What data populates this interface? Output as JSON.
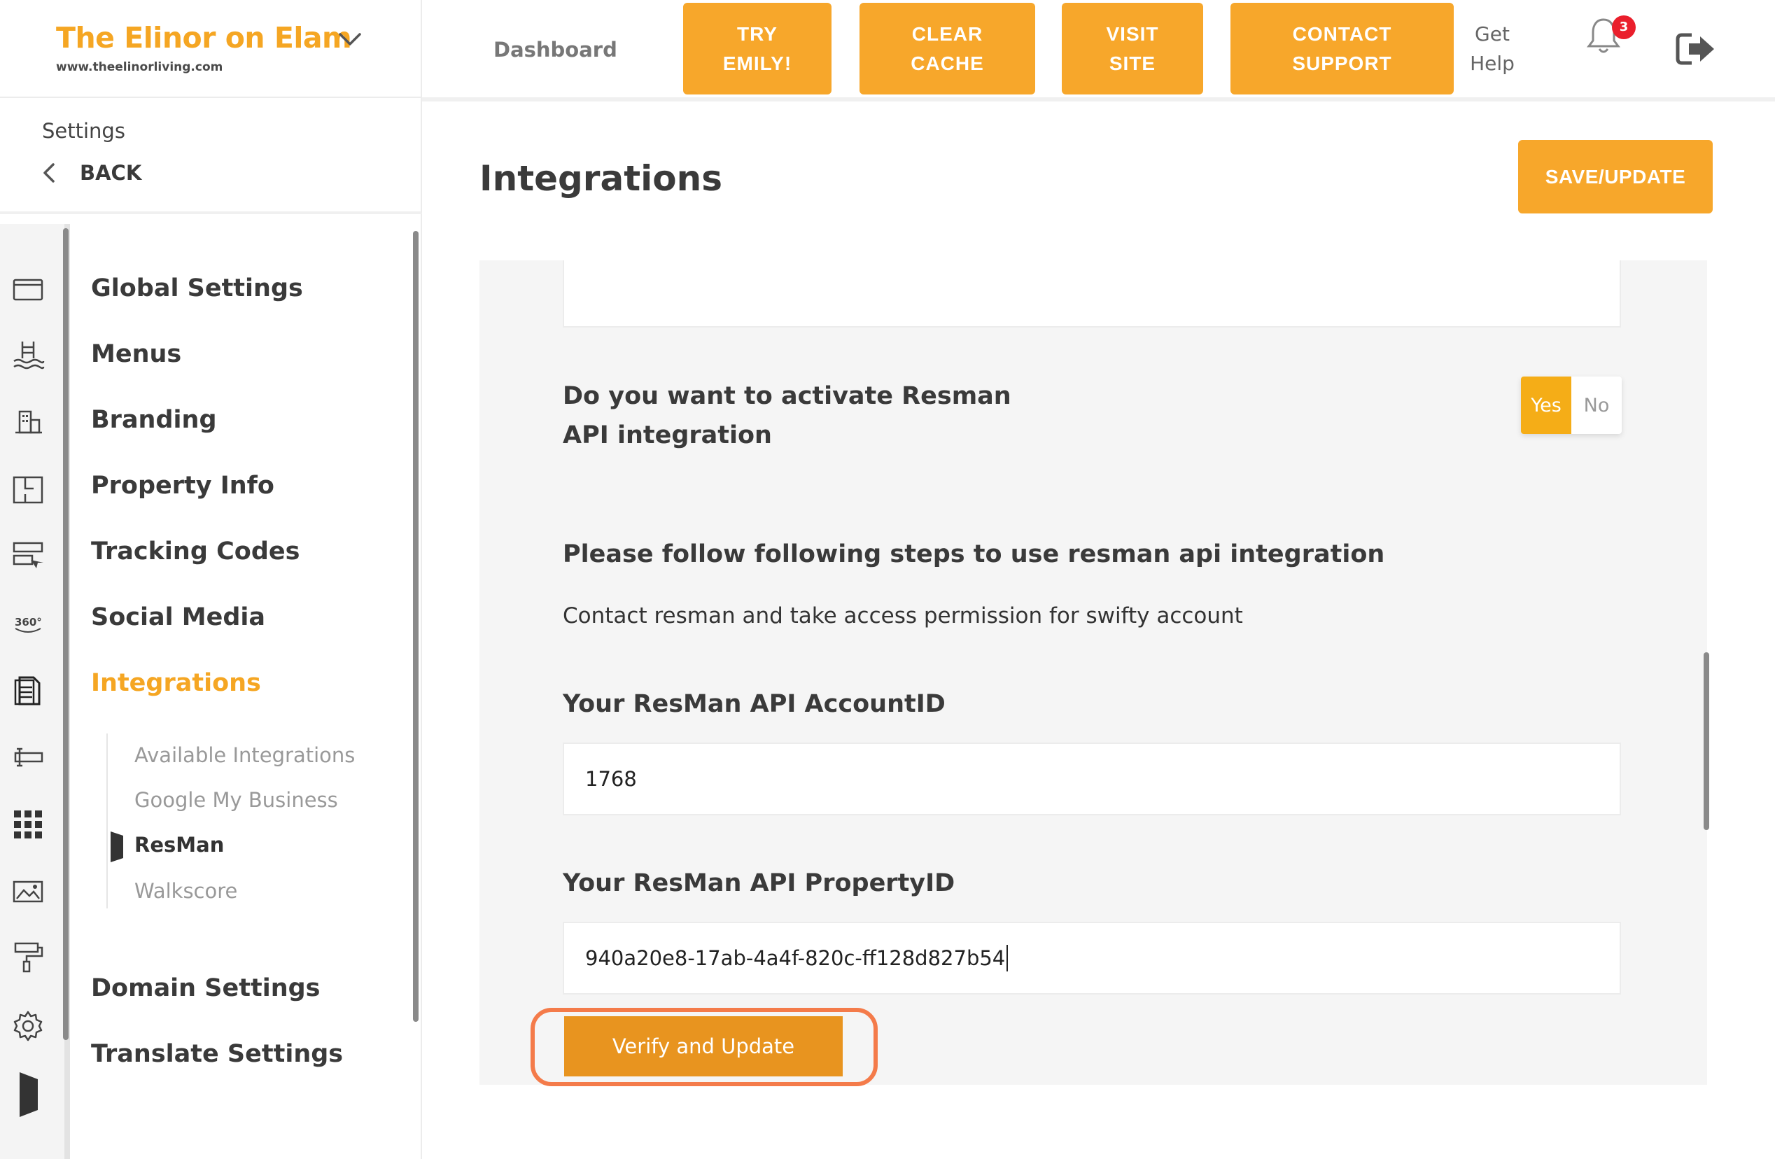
{
  "brand": {
    "name": "The Elinor on Elam",
    "url": "www.theelinorliving.com"
  },
  "topbar": {
    "dashboard": "Dashboard",
    "buttons": [
      "TRY\nEMILY!",
      "CLEAR\nCACHE",
      "VISIT\nSITE",
      "CONTACT\nSUPPORT"
    ],
    "get_help": "Get\nHelp",
    "notification_count": "3"
  },
  "sidebar": {
    "settings_label": "Settings",
    "back_label": "BACK",
    "menu": [
      {
        "label": "Global Settings"
      },
      {
        "label": "Menus"
      },
      {
        "label": "Branding"
      },
      {
        "label": "Property Info"
      },
      {
        "label": "Tracking Codes"
      },
      {
        "label": "Social Media"
      },
      {
        "label": "Integrations"
      },
      {
        "label": "Domain Settings"
      },
      {
        "label": "Translate Settings"
      }
    ],
    "active_menu": "Integrations",
    "submenu": [
      {
        "label": "Available Integrations"
      },
      {
        "label": "Google My Business"
      },
      {
        "label": "ResMan"
      },
      {
        "label": "Walkscore"
      }
    ],
    "active_submenu": "ResMan"
  },
  "main": {
    "title": "Integrations",
    "save_label": "SAVE/UPDATE",
    "question": "Do you want to activate Resman API integration",
    "toggle": {
      "yes": "Yes",
      "no": "No",
      "selected": "Yes"
    },
    "steps_title": "Please follow following steps to use resman api integration",
    "steps_text": "Contact resman and take access permission for swifty account",
    "account_label": "Your ResMan API AccountID",
    "account_value": "1768",
    "property_label": "Your ResMan API PropertyID",
    "property_value": "940a20e8-17ab-4a4f-820c-ff128d827b54",
    "verify_label": "Verify and Update"
  },
  "colors": {
    "accent": "#f7a72b",
    "brand": "#f5a623",
    "verify": "#e8941f",
    "highlight_ring": "#f47b4a",
    "badge": "#ea1f2c"
  }
}
